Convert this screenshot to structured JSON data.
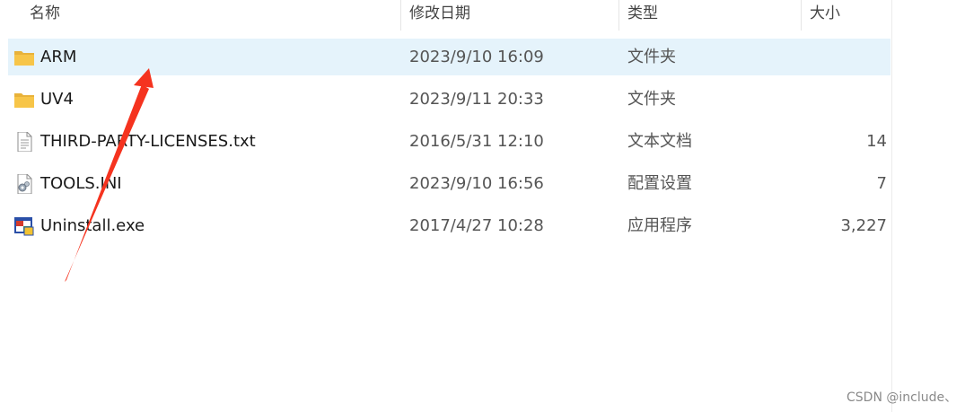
{
  "columns": {
    "name": "名称",
    "date": "修改日期",
    "type": "类型",
    "size": "大小"
  },
  "files": [
    {
      "name": "ARM",
      "date": "2023/9/10 16:09",
      "type": "文件夹",
      "size": "",
      "icon": "folder-icon",
      "selected": true
    },
    {
      "name": "UV4",
      "date": "2023/9/11 20:33",
      "type": "文件夹",
      "size": "",
      "icon": "folder-icon",
      "selected": false
    },
    {
      "name": "THIRD-PARTY-LICENSES.txt",
      "date": "2016/5/31 12:10",
      "type": "文本文档",
      "size": "14",
      "icon": "text-file-icon",
      "selected": false
    },
    {
      "name": "TOOLS.INI",
      "date": "2023/9/10 16:56",
      "type": "配置设置",
      "size": "7",
      "icon": "settings-file-icon",
      "selected": false
    },
    {
      "name": "Uninstall.exe",
      "date": "2017/4/27 10:28",
      "type": "应用程序",
      "size": "3,227",
      "icon": "application-icon",
      "selected": false
    }
  ],
  "watermark": "CSDN @include、",
  "colors": {
    "selection": "#e5f3fb",
    "annotation_arrow": "#f5331f",
    "folder": "#f7c548"
  }
}
